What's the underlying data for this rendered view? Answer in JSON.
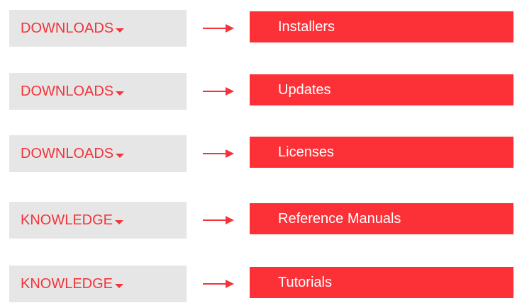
{
  "colors": {
    "accent": "#fc3138",
    "button_bg": "#e6e6e6",
    "button_text": "#f0353b",
    "item_text": "#ffffff"
  },
  "rows": [
    {
      "menu_label": "DOWNLOADS",
      "item_label": "Installers"
    },
    {
      "menu_label": "DOWNLOADS",
      "item_label": "Updates"
    },
    {
      "menu_label": "DOWNLOADS",
      "item_label": "Licenses"
    },
    {
      "menu_label": "KNOWLEDGE",
      "item_label": "Reference Manuals"
    },
    {
      "menu_label": "KNOWLEDGE",
      "item_label": "Tutorials"
    }
  ]
}
